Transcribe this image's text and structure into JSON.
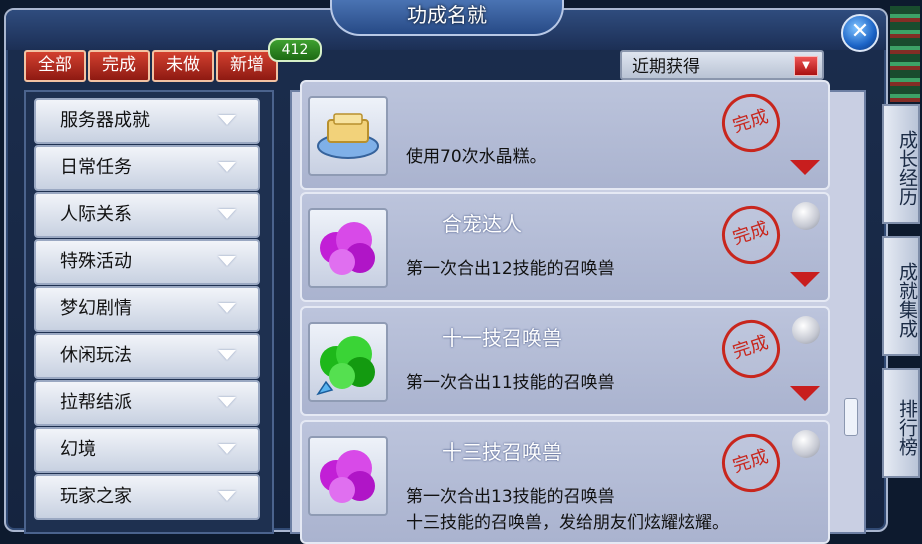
{
  "window": {
    "title": "功成名就"
  },
  "close_symbol": "✕",
  "filters": [
    {
      "label": "全部"
    },
    {
      "label": "完成"
    },
    {
      "label": "未做"
    },
    {
      "label": "新增"
    }
  ],
  "new_count": "412",
  "sort": {
    "selected": "近期获得",
    "arrow_icon": "dropdown-arrow-icon"
  },
  "categories": [
    "服务器成就",
    "日常任务",
    "人际关系",
    "特殊活动",
    "梦幻剧情",
    "休闲玩法",
    "拉帮结派",
    "幻境",
    "玩家之家"
  ],
  "achievements": [
    {
      "title": "",
      "description": "使用70次水晶糕。",
      "description2": "",
      "icon": "crystal-cake-icon",
      "stamp": "完成"
    },
    {
      "title": "合宠达人",
      "description": "第一次合出12技能的召唤兽",
      "description2": "",
      "icon": "purple-summon-beast-icon",
      "stamp": "完成"
    },
    {
      "title": "十一技召唤兽",
      "description": "第一次合出11技能的召唤兽",
      "description2": "",
      "icon": "green-summon-beast-icon",
      "stamp": "完成"
    },
    {
      "title": "十三技召唤兽",
      "description": "第一次合出13技能的召唤兽",
      "description2": "十三技能的召唤兽，发给朋友们炫耀炫耀。",
      "icon": "purple-summon-beast-icon",
      "stamp": "完成"
    }
  ],
  "side_tabs": [
    "成长经历",
    "成就集成",
    "排行榜"
  ],
  "colors": {
    "accent_red": "#c8261d",
    "badge_green": "#2e8a22",
    "panel_bg": "#c9cfe3"
  }
}
